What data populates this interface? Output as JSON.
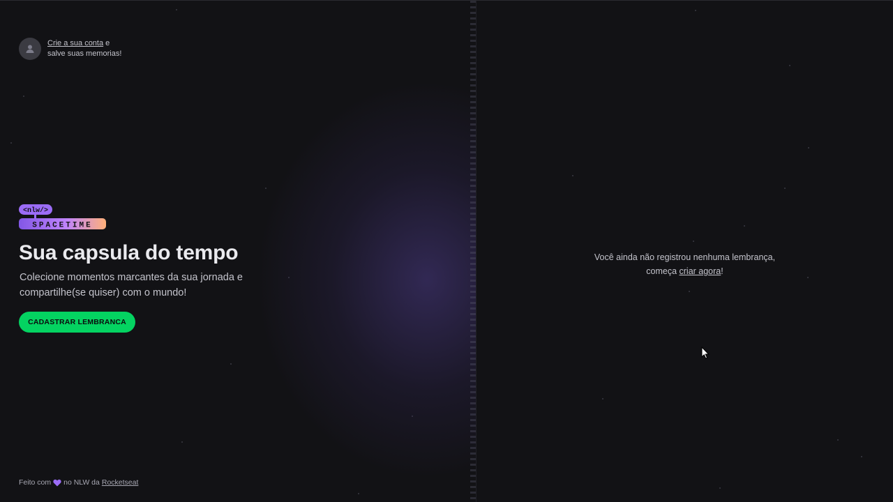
{
  "signin": {
    "link_label": "Crie a sua conta",
    "text_after_link": " e",
    "text_line2": "salve suas memorias!",
    "avatar_icon": "user-icon"
  },
  "logo": {
    "badge_text": "<nlw/>",
    "wordmark": "SPACETIME",
    "colors": {
      "badge": "#9b6cf6",
      "gradient_start": "#8257e5",
      "gradient_end": "#ffb07a"
    }
  },
  "hero": {
    "title": "Sua capsula do tempo",
    "subtitle": "Colecione momentos marcantes da sua jornada e compartilhe(se quiser) com o mundo!",
    "cta_label": "CADASTRAR LEMBRANCA"
  },
  "footer": {
    "prefix": "Feito com",
    "heart_icon": "purple-heart-icon",
    "middle": "no NLW da",
    "link_label": "Rocketseat"
  },
  "empty_state": {
    "line1": "Você ainda não registrou nenhuma lembrança,",
    "line2_prefix": "começa ",
    "link_label": "criar agora",
    "line2_suffix": "!"
  },
  "colors": {
    "background": "#121215",
    "accent_green": "#04d361",
    "text": "#c4c4cc"
  }
}
